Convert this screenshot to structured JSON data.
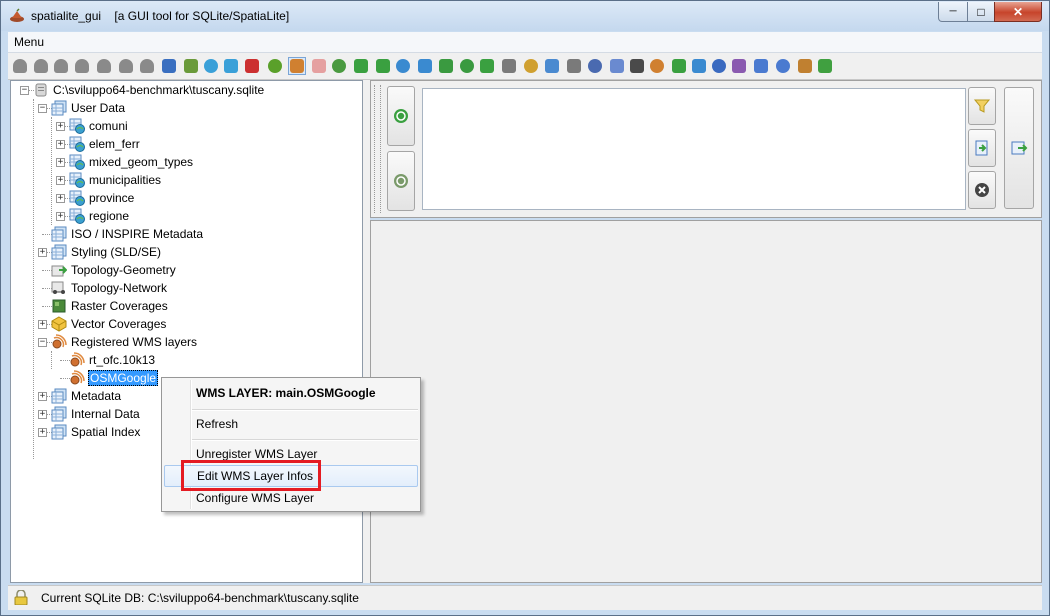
{
  "window": {
    "app_name": "spatialite_gui",
    "subtitle": "[a GUI tool for SQLite/SpatiaLite]",
    "minimize_glyph": "─",
    "maximize_glyph": "□",
    "close_glyph": "✕"
  },
  "menubar": {
    "menu_label": "Menu"
  },
  "toolbar": {
    "icons": [
      "connect-icon",
      "connect-memory-icon",
      "disconnect-icon",
      "create-db-icon",
      "memory-db-icon",
      "memory-db-save-icon",
      "memory-db-clone-icon",
      "vacuum-icon",
      "sql-script-icon",
      "load-shapefile-icon",
      "virtual-shapefile-icon",
      "load-network-icon",
      "check-geometry-icon",
      "map-icon",
      "sanitize-icon",
      "eraser-icon",
      "load-txt-icon",
      "virtual-csv-icon",
      "load-dbf-icon",
      "virtual-dbf-icon",
      "load-xl-icon",
      "virtual-xl-icon",
      "load-xml-icon",
      "import-wfs-icon",
      "import-dxf-icon",
      "export-icon",
      "attach-icon",
      "sql-log-icon",
      "db-status-icon",
      "check-duplicates-icon",
      "text-align-icon",
      "wms-icon",
      "srid-icon",
      "geometry-icon",
      "blade-icon",
      "charset-icon",
      "help-icon",
      "about-icon",
      "exit-icon"
    ],
    "colors": [
      "#8a8a8a",
      "#8a8a8a",
      "#8a8a8a",
      "#8a8a8a",
      "#8a8a8a",
      "#8a8a8a",
      "#8a8a8a",
      "#3a6fc0",
      "#6a9a3a",
      "#3aa0d8",
      "#3aa0d8",
      "#cc3030",
      "#5aa02a",
      "#d08030",
      "#e5a0a0",
      "#4a9a40",
      "#3aa040",
      "#3aa040",
      "#3a8ad0",
      "#3a8ad0",
      "#3a9a40",
      "#3a9a40",
      "#3aa040",
      "#7a7a7a",
      "#d0a030",
      "#4a8ad0",
      "#7a7a7a",
      "#4a6ab0",
      "#6a8ad0",
      "#4a4a4a",
      "#d08030",
      "#3aa040",
      "#3a8ad0",
      "#3a6ac0",
      "#8a5ab0",
      "#4a7ad0",
      "#4a7ad0",
      "#c08030",
      "#40a040"
    ],
    "active_index": 13
  },
  "tree": {
    "root": "C:\\sviluppo64-benchmark\\tuscany.sqlite",
    "user_data": "User Data",
    "tables": [
      "comuni",
      "elem_ferr",
      "mixed_geom_types",
      "municipalities",
      "province",
      "regione"
    ],
    "iso_metadata": "ISO / INSPIRE Metadata",
    "styling": "Styling (SLD/SE)",
    "topology_geometry": "Topology-Geometry",
    "topology_network": "Topology-Network",
    "raster_coverages": "Raster Coverages",
    "vector_coverages": "Vector Coverages",
    "wms_layers": "Registered WMS layers",
    "wms_items": [
      "rt_ofc.10k13",
      "OSMGoogle"
    ],
    "metadata": "Metadata",
    "internal_data": "Internal Data",
    "spatial_index": "Spatial Index",
    "expand_plus": "+",
    "expand_minus": "−"
  },
  "context_menu": {
    "header": "WMS LAYER: main.OSMGoogle",
    "refresh": "Refresh",
    "unregister": "Unregister WMS Layer",
    "edit_infos": "Edit WMS Layer Infos",
    "configure": "Configure WMS Layer"
  },
  "status": {
    "text": "Current SQLite DB: C:\\sviluppo64-benchmark\\tuscany.sqlite"
  }
}
